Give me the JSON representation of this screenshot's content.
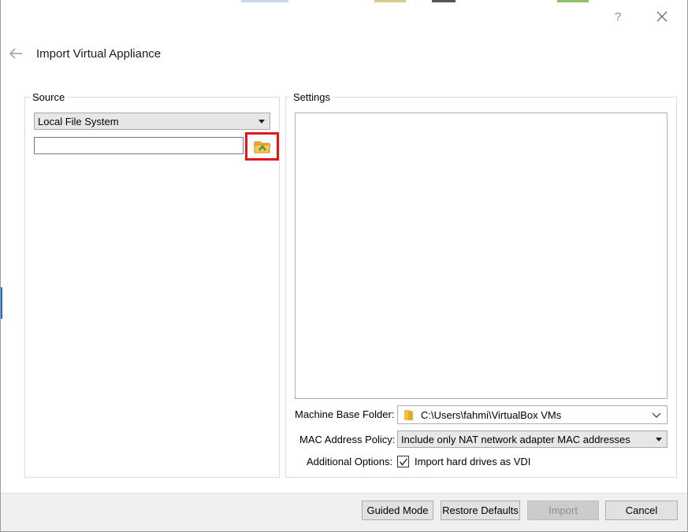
{
  "window": {
    "help_label": "?",
    "title": "Import Virtual Appliance"
  },
  "source": {
    "group_label": "Source",
    "source_select_value": "Local File System",
    "file_input_value": "",
    "file_input_placeholder": ""
  },
  "settings": {
    "group_label": "Settings",
    "machine_base_folder_label": "Machine Base Folder:",
    "machine_base_folder_value": "C:\\Users\\fahmi\\VirtualBox VMs",
    "mac_policy_label": "MAC Address Policy:",
    "mac_policy_value": "Include only NAT network adapter MAC addresses",
    "additional_options_label": "Additional Options:",
    "import_vdi_label": "Import hard drives as VDI",
    "import_vdi_checked": true
  },
  "buttons": {
    "guided_mode": "Guided Mode",
    "restore_defaults": "Restore Defaults",
    "import": "Import",
    "cancel": "Cancel"
  },
  "colors": {
    "highlight": "#e8141b",
    "folder_icon": "#f0a830",
    "disabled_text": "#8f8f8f"
  },
  "icons": {
    "back": "arrow-left-icon",
    "close": "close-icon",
    "open_file": "folder-open-icon",
    "folder": "folder-icon",
    "chevron": "chevron-down-icon",
    "check": "check-icon"
  }
}
